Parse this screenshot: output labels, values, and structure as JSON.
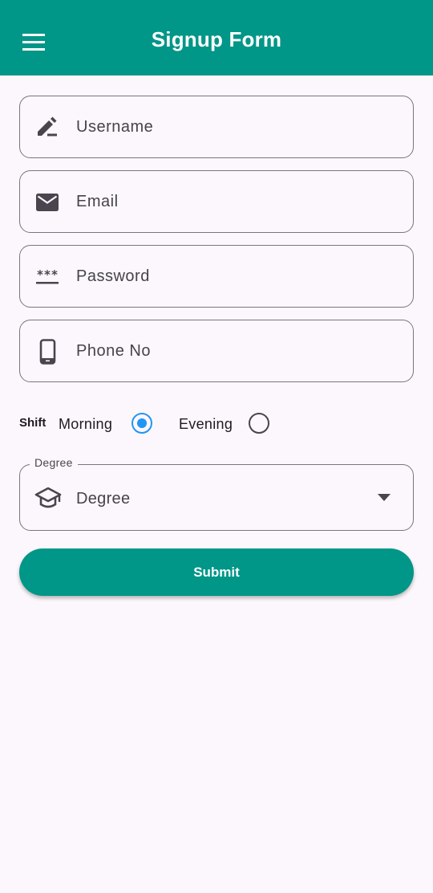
{
  "appbar": {
    "title": "Signup Form",
    "menu_icon": "menu-icon",
    "color": "#009688"
  },
  "form": {
    "fields": [
      {
        "placeholder": "Username",
        "value": "",
        "icon": "edit-pen-icon"
      },
      {
        "placeholder": "Email",
        "value": "",
        "icon": "email-icon"
      },
      {
        "placeholder": "Password",
        "value": "",
        "icon": "password-icon"
      },
      {
        "placeholder": "Phone No",
        "value": "",
        "icon": "phone-icon"
      }
    ],
    "shift": {
      "label": "Shift",
      "options": [
        "Morning",
        "Evening"
      ],
      "selected": "Morning",
      "selected_color": "#2196f3"
    },
    "degree": {
      "label": "Degree",
      "value": "Degree",
      "icon": "graduation-cap-icon"
    },
    "submit_label": "Submit"
  }
}
